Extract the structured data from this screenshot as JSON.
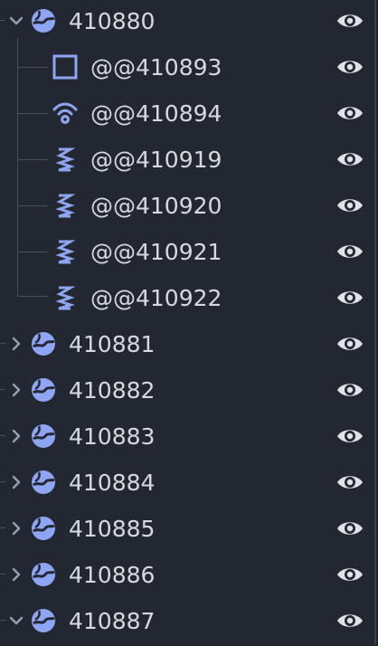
{
  "colors": {
    "background": "#232731",
    "text": "#d7d9df",
    "icon_accent": "#8da5f3",
    "eye": "#e0e2e7",
    "guide": "#4a4f5b"
  },
  "tree": {
    "nodes": [
      {
        "label": "410880",
        "icon": "globe-icon",
        "arrow": "chevron-down-icon"
      },
      {
        "label": "@@410893",
        "icon": "square-icon"
      },
      {
        "label": "@@410894",
        "icon": "signal-icon"
      },
      {
        "label": "@@410919",
        "icon": "spring-icon"
      },
      {
        "label": "@@410920",
        "icon": "spring-icon"
      },
      {
        "label": "@@410921",
        "icon": "spring-icon"
      },
      {
        "label": "@@410922",
        "icon": "spring-icon"
      },
      {
        "label": "410881",
        "icon": "globe-icon",
        "arrow": "chevron-right-icon"
      },
      {
        "label": "410882",
        "icon": "globe-icon",
        "arrow": "chevron-right-icon"
      },
      {
        "label": "410883",
        "icon": "globe-icon",
        "arrow": "chevron-right-icon"
      },
      {
        "label": "410884",
        "icon": "globe-icon",
        "arrow": "chevron-right-icon"
      },
      {
        "label": "410885",
        "icon": "globe-icon",
        "arrow": "chevron-right-icon"
      },
      {
        "label": "410886",
        "icon": "globe-icon",
        "arrow": "chevron-right-icon"
      },
      {
        "label": "410887",
        "icon": "globe-icon",
        "arrow": "chevron-down-icon"
      }
    ]
  }
}
